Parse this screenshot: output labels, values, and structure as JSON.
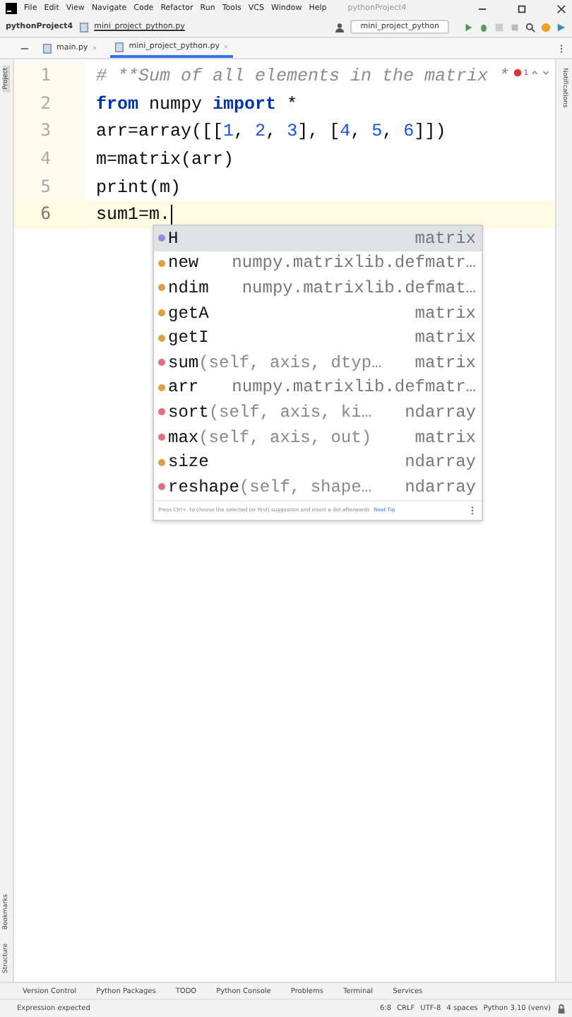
{
  "window": {
    "menu": [
      "File",
      "Edit",
      "View",
      "Navigate",
      "Code",
      "Refactor",
      "Run",
      "Tools",
      "VCS",
      "Window",
      "Help"
    ],
    "title": "pythonProject4"
  },
  "navbar": {
    "project": "pythonProject4",
    "file": "mini_project_python.py",
    "run_config": "mini_project_python"
  },
  "tabs": [
    {
      "label": "main.py",
      "selected": false
    },
    {
      "label": "mini_project_python.py",
      "selected": true
    }
  ],
  "left_strip": {
    "top": [
      {
        "label": "Project",
        "selected": true
      }
    ],
    "bottom": [
      {
        "label": "Bookmarks",
        "selected": false
      },
      {
        "label": "Structure",
        "selected": false
      }
    ]
  },
  "right_strip": [
    "Notifications"
  ],
  "inspections": {
    "errors": "1"
  },
  "editor": {
    "lines": [
      {
        "number": "1",
        "current": false,
        "segments": [
          {
            "text": "# **Sum of all elements in the matrix *",
            "kind": "comment"
          }
        ]
      },
      {
        "number": "2",
        "current": false,
        "segments": [
          {
            "text": "from",
            "kind": "keyword"
          },
          {
            "text": " numpy ",
            "kind": "plain"
          },
          {
            "text": "import",
            "kind": "keyword"
          },
          {
            "text": " *",
            "kind": "plain"
          }
        ]
      },
      {
        "number": "3",
        "current": false,
        "segments": [
          {
            "text": "arr=array([[",
            "kind": "plain"
          },
          {
            "text": "1",
            "kind": "number"
          },
          {
            "text": ", ",
            "kind": "plain"
          },
          {
            "text": "2",
            "kind": "number"
          },
          {
            "text": ", ",
            "kind": "plain"
          },
          {
            "text": "3",
            "kind": "number"
          },
          {
            "text": "], [",
            "kind": "plain"
          },
          {
            "text": "4",
            "kind": "number"
          },
          {
            "text": ", ",
            "kind": "plain"
          },
          {
            "text": "5",
            "kind": "number"
          },
          {
            "text": ", ",
            "kind": "plain"
          },
          {
            "text": "6",
            "kind": "number"
          },
          {
            "text": "]])",
            "kind": "plain"
          }
        ]
      },
      {
        "number": "4",
        "current": false,
        "segments": [
          {
            "text": "m=matrix(arr)",
            "kind": "plain"
          }
        ]
      },
      {
        "number": "5",
        "current": false,
        "segments": [
          {
            "text": "print(m)",
            "kind": "plain"
          }
        ]
      },
      {
        "number": "6",
        "current": true,
        "segments": [
          {
            "text": "sum1=m.",
            "kind": "plain"
          }
        ]
      }
    ]
  },
  "completion": {
    "items": [
      {
        "name": "H",
        "type": "matrix",
        "kind": "field",
        "selected": true
      },
      {
        "name": "new",
        "type": "numpy.matrixlib.defmatr…",
        "kind": "variable",
        "selected": false
      },
      {
        "name": "ndim",
        "type": "numpy.matrixlib.defmat…",
        "kind": "variable",
        "selected": false
      },
      {
        "name": "getA",
        "type": "matrix",
        "kind": "variable",
        "selected": false
      },
      {
        "name": "getI",
        "type": "matrix",
        "kind": "variable",
        "selected": false
      },
      {
        "name": "sum",
        "params": "(self, axis, dtyp…",
        "type": "matrix",
        "kind": "method",
        "selected": false
      },
      {
        "name": "arr",
        "type": "numpy.matrixlib.defmatr…",
        "kind": "variable",
        "selected": false
      },
      {
        "name": "sort",
        "params": "(self, axis, ki…",
        "type": "ndarray",
        "kind": "method",
        "selected": false
      },
      {
        "name": "max",
        "params": "(self, axis, out)",
        "type": "matrix",
        "kind": "method",
        "selected": false
      },
      {
        "name": "size",
        "type": "ndarray",
        "kind": "variable",
        "selected": false
      },
      {
        "name": "reshape",
        "params": "(self, shape…",
        "type": "ndarray",
        "kind": "method",
        "selected": false
      }
    ],
    "hint": "Press Ctrl+. to choose the selected (or first) suggestion and insert a dot afterwards",
    "next_tip": "Next Tip"
  },
  "tool_windows": [
    "Version Control",
    "Python Packages",
    "TODO",
    "Python Console",
    "Problems",
    "Terminal",
    "Services"
  ],
  "status_bar": {
    "message": "Expression expected",
    "items": [
      "6:8",
      "CRLF",
      "UTF-8",
      "4 spaces",
      "Python 3.10 (venv)"
    ]
  }
}
